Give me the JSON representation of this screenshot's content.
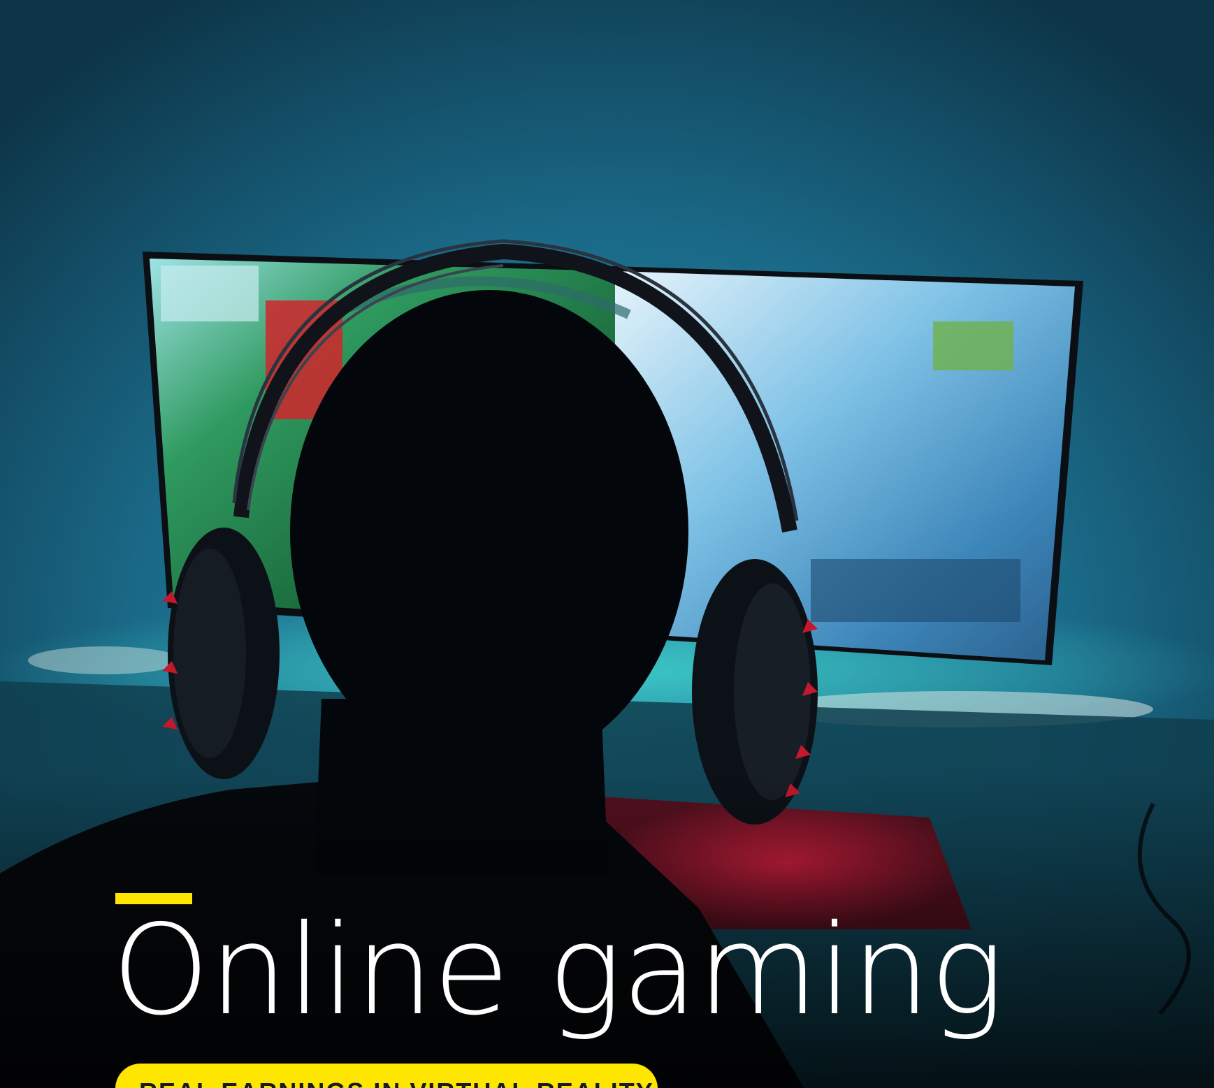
{
  "headline": "Online gaming",
  "tagline": "REAL EARNINGS IN VIRTUAL REALITY",
  "colors": {
    "accent": "#ffe600",
    "headline": "#ffffff",
    "tagline_text": "#1a1a24"
  },
  "image_subject": "gamer-with-headset-photo"
}
